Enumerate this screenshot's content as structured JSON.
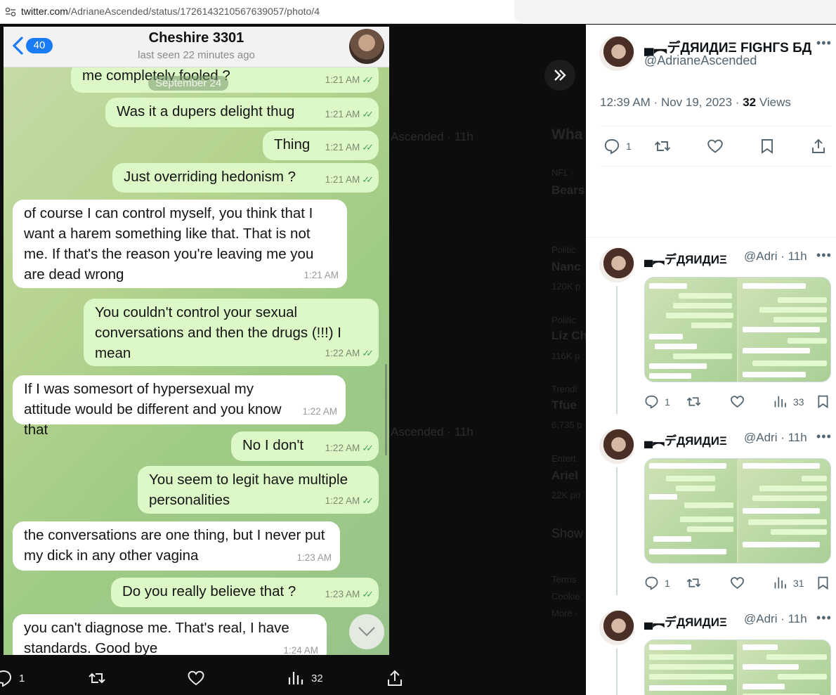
{
  "browser": {
    "url_host": "twitter.com",
    "url_path": "/AdrianeAscended/status/1726143210567639057/photo/4"
  },
  "phone": {
    "back_count": "40",
    "contact_name": "Cheshire 3301",
    "last_seen": "last seen 22 minutes ago",
    "date_pill": "September 24",
    "messages": [
      {
        "dir": "out",
        "text": "me completely fooled ?",
        "time": "1:21 AM"
      },
      {
        "dir": "out",
        "text": "Was it a dupers delight thug",
        "time": "1:21 AM"
      },
      {
        "dir": "out",
        "text": "Thing",
        "time": "1:21 AM"
      },
      {
        "dir": "out",
        "text": "Just overriding hedonism ?",
        "time": "1:21 AM"
      },
      {
        "dir": "in",
        "text": "of course I can control myself, you think that I want a harem something like that. That is not me. If that's the reason you're leaving me you are dead wrong",
        "time": "1:21 AM"
      },
      {
        "dir": "out",
        "text": "You couldn't control your sexual conversations and then the drugs (!!!) I mean",
        "time": "1:22 AM"
      },
      {
        "dir": "in",
        "text": "If I was somesort of hypersexual my attitude would be different and you know that",
        "time": "1:22 AM"
      },
      {
        "dir": "out",
        "text": "No I don't",
        "time": "1:22 AM"
      },
      {
        "dir": "out",
        "text": "You seem to legit have multiple personalities",
        "time": "1:22 AM"
      },
      {
        "dir": "in",
        "text": "the conversations are one thing, but I never put my dick in any other vagina",
        "time": "1:23 AM"
      },
      {
        "dir": "out",
        "text": "Do you really believe that ?",
        "time": "1:23 AM"
      },
      {
        "dir": "in",
        "text": "you can't diagnose me. That's real, I have standards. Good bye",
        "time": "1:24 AM"
      }
    ]
  },
  "action_bar": {
    "reply_count": "1",
    "views_count": "32"
  },
  "main_tweet": {
    "author_name": "▄︻デДЯИДИΞ FIGHГS БД",
    "author_handle": "@AdrianeAscended",
    "time": "12:39 AM",
    "date": "Nov 19, 2023",
    "views": "32",
    "views_label": "Views",
    "reply_count": "1"
  },
  "replies": [
    {
      "author_name": "▄︻デДЯИДИΞ",
      "handle_time": "@Adri · 11h",
      "reply_count": "1",
      "views": "33"
    },
    {
      "author_name": "▄︻デДЯИДИΞ",
      "handle_time": "@Adri · 11h",
      "reply_count": "1",
      "views": "31"
    },
    {
      "author_name": "▄︻デДЯИДИΞ",
      "handle_time": "@Adri · 11h"
    }
  ],
  "background_ghost": {
    "sidebar_title": "Wha",
    "items": [
      "NFL ·",
      "Bears",
      "Politic",
      "Nanc",
      "120K p",
      "Politic",
      "Liz Ch",
      "116K p",
      "Trendi",
      "Tfue",
      "6,735 p",
      "Entert",
      "Ariel",
      "22K po",
      "Show",
      "Terms",
      "Cookie",
      "More ·"
    ],
    "handle_a": "Ascended · 11h",
    "handle_b": "Ascended · 11h"
  },
  "colors": {
    "outgoing_bubble": "#dcf8c6",
    "incoming_bubble": "#ffffff",
    "badge_blue": "#1a7cf5",
    "dark_bg": "#0d0d0d"
  }
}
